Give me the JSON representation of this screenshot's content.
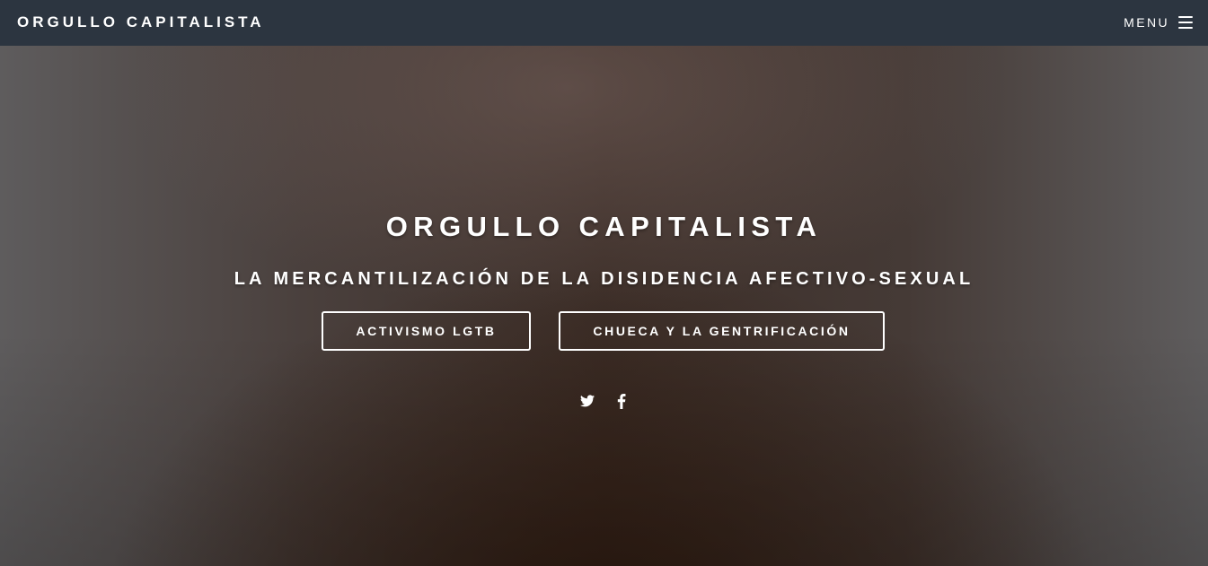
{
  "navbar": {
    "brand": "ORGULLO CAPITALISTA",
    "menu_label": "MENU",
    "menu_icon": "hamburger-icon"
  },
  "hero": {
    "title": "ORGULLO CAPITALISTA",
    "subtitle": "LA MERCANTILIZACIÓN DE LA DISIDENCIA AFECTIVO-SEXUAL",
    "buttons": [
      {
        "label": "ACTIVISMO LGTB"
      },
      {
        "label": "CHUECA Y LA GENTRIFICACIÓN"
      }
    ],
    "social": [
      {
        "icon": "twitter-icon"
      },
      {
        "icon": "facebook-icon"
      }
    ]
  },
  "colors": {
    "navbar_bg": "#2c3540",
    "text": "#ffffff",
    "button_border": "#ffffff"
  }
}
